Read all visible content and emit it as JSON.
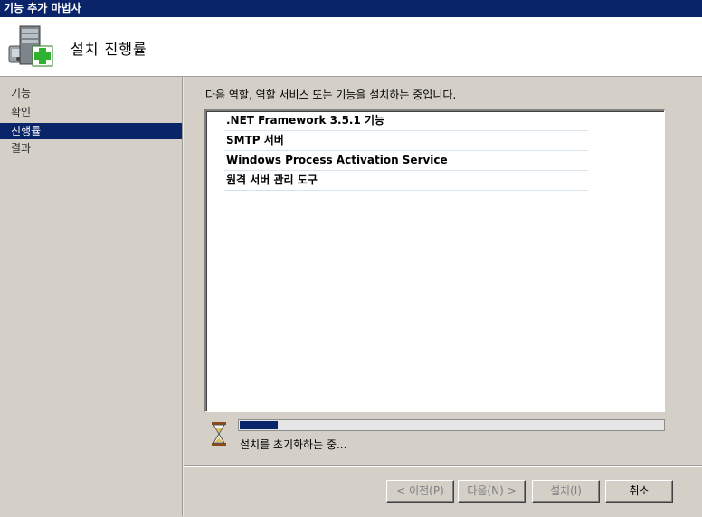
{
  "window": {
    "title": "기능 추가 마법사"
  },
  "header": {
    "title": "설치 진행률",
    "icon": "server-add-icon"
  },
  "sidebar": {
    "items": [
      {
        "label": "기능",
        "active": false
      },
      {
        "label": "확인",
        "active": false
      },
      {
        "label": "진행률",
        "active": true
      },
      {
        "label": "결과",
        "active": false
      }
    ]
  },
  "content": {
    "description": "다음 역할, 역할 서비스 또는 기능을 설치하는 중입니다.",
    "items": [
      ".NET Framework 3.5.1 기능",
      "SMTP 서버",
      "Windows Process Activation Service",
      "원격 서버 관리 도구"
    ]
  },
  "progress": {
    "percent": 9,
    "status": "설치를 초기화하는 중...",
    "icon": "hourglass-icon"
  },
  "buttons": {
    "prev": "< 이전(P)",
    "next": "다음(N) >",
    "install": "설치(I)",
    "cancel": "취소"
  },
  "colors": {
    "titlebar": "#0a246a",
    "selection": "#0a246a",
    "progress_fill": "#0a246a"
  }
}
